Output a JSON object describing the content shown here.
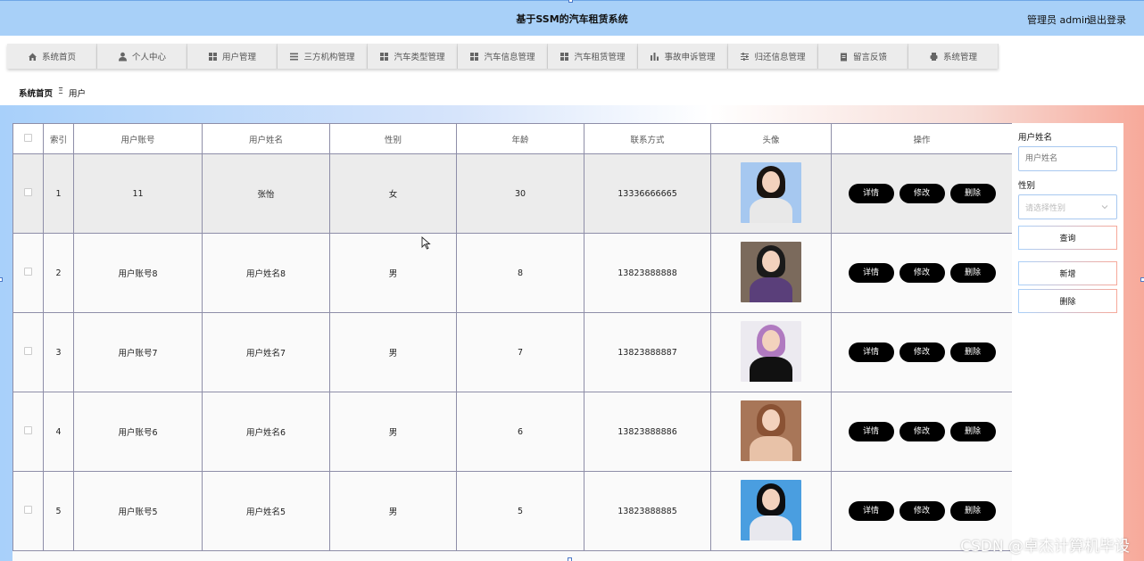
{
  "header": {
    "title": "基于SSM的汽车租赁系统",
    "user": "管理员 admin",
    "logout": "退出登录"
  },
  "nav": [
    {
      "label": "系统首页",
      "icon": "home-icon"
    },
    {
      "label": "个人中心",
      "icon": "person-icon"
    },
    {
      "label": "用户管理",
      "icon": "grid-icon"
    },
    {
      "label": "三方机构管理",
      "icon": "list-icon"
    },
    {
      "label": "汽车类型管理",
      "icon": "grid-icon"
    },
    {
      "label": "汽车信息管理",
      "icon": "grid-icon"
    },
    {
      "label": "汽车租赁管理",
      "icon": "grid-icon"
    },
    {
      "label": "事故申诉管理",
      "icon": "chart-icon"
    },
    {
      "label": "归还信息管理",
      "icon": "sliders-icon"
    },
    {
      "label": "留言反馈",
      "icon": "clipboard-icon"
    },
    {
      "label": "系统管理",
      "icon": "printer-icon"
    }
  ],
  "breadcrumb": {
    "home": "系统首页",
    "separator": "Ξ",
    "current": "用户"
  },
  "table": {
    "columns": [
      "",
      "索引",
      "用户账号",
      "用户姓名",
      "性别",
      "年龄",
      "联系方式",
      "头像",
      "操作"
    ],
    "actions": {
      "detail": "详情",
      "edit": "修改",
      "delete": "删除"
    },
    "rows": [
      {
        "index": "1",
        "account": "11",
        "name": "张怡",
        "gender": "女",
        "age": "30",
        "phone": "13336666665",
        "avatar": "avatar-photo-1"
      },
      {
        "index": "2",
        "account": "用户账号8",
        "name": "用户姓名8",
        "gender": "男",
        "age": "8",
        "phone": "13823888888",
        "avatar": "avatar-photo-2"
      },
      {
        "index": "3",
        "account": "用户账号7",
        "name": "用户姓名7",
        "gender": "男",
        "age": "7",
        "phone": "13823888887",
        "avatar": "avatar-photo-3"
      },
      {
        "index": "4",
        "account": "用户账号6",
        "name": "用户姓名6",
        "gender": "男",
        "age": "6",
        "phone": "13823888886",
        "avatar": "avatar-photo-4"
      },
      {
        "index": "5",
        "account": "用户账号5",
        "name": "用户姓名5",
        "gender": "男",
        "age": "5",
        "phone": "13823888885",
        "avatar": "avatar-photo-5"
      }
    ]
  },
  "search": {
    "name_label": "用户姓名",
    "name_placeholder": "用户姓名",
    "gender_label": "性别",
    "gender_placeholder": "请选择性别",
    "query": "查询",
    "add": "新增",
    "delete": "删除"
  },
  "watermark": "CSDN @卓杰计算机毕设",
  "colors": {
    "header_bg": "#a8d0f8",
    "button_bg": "#000000",
    "gradient_left": "#a8d0fa",
    "gradient_right": "#f7a99a"
  }
}
